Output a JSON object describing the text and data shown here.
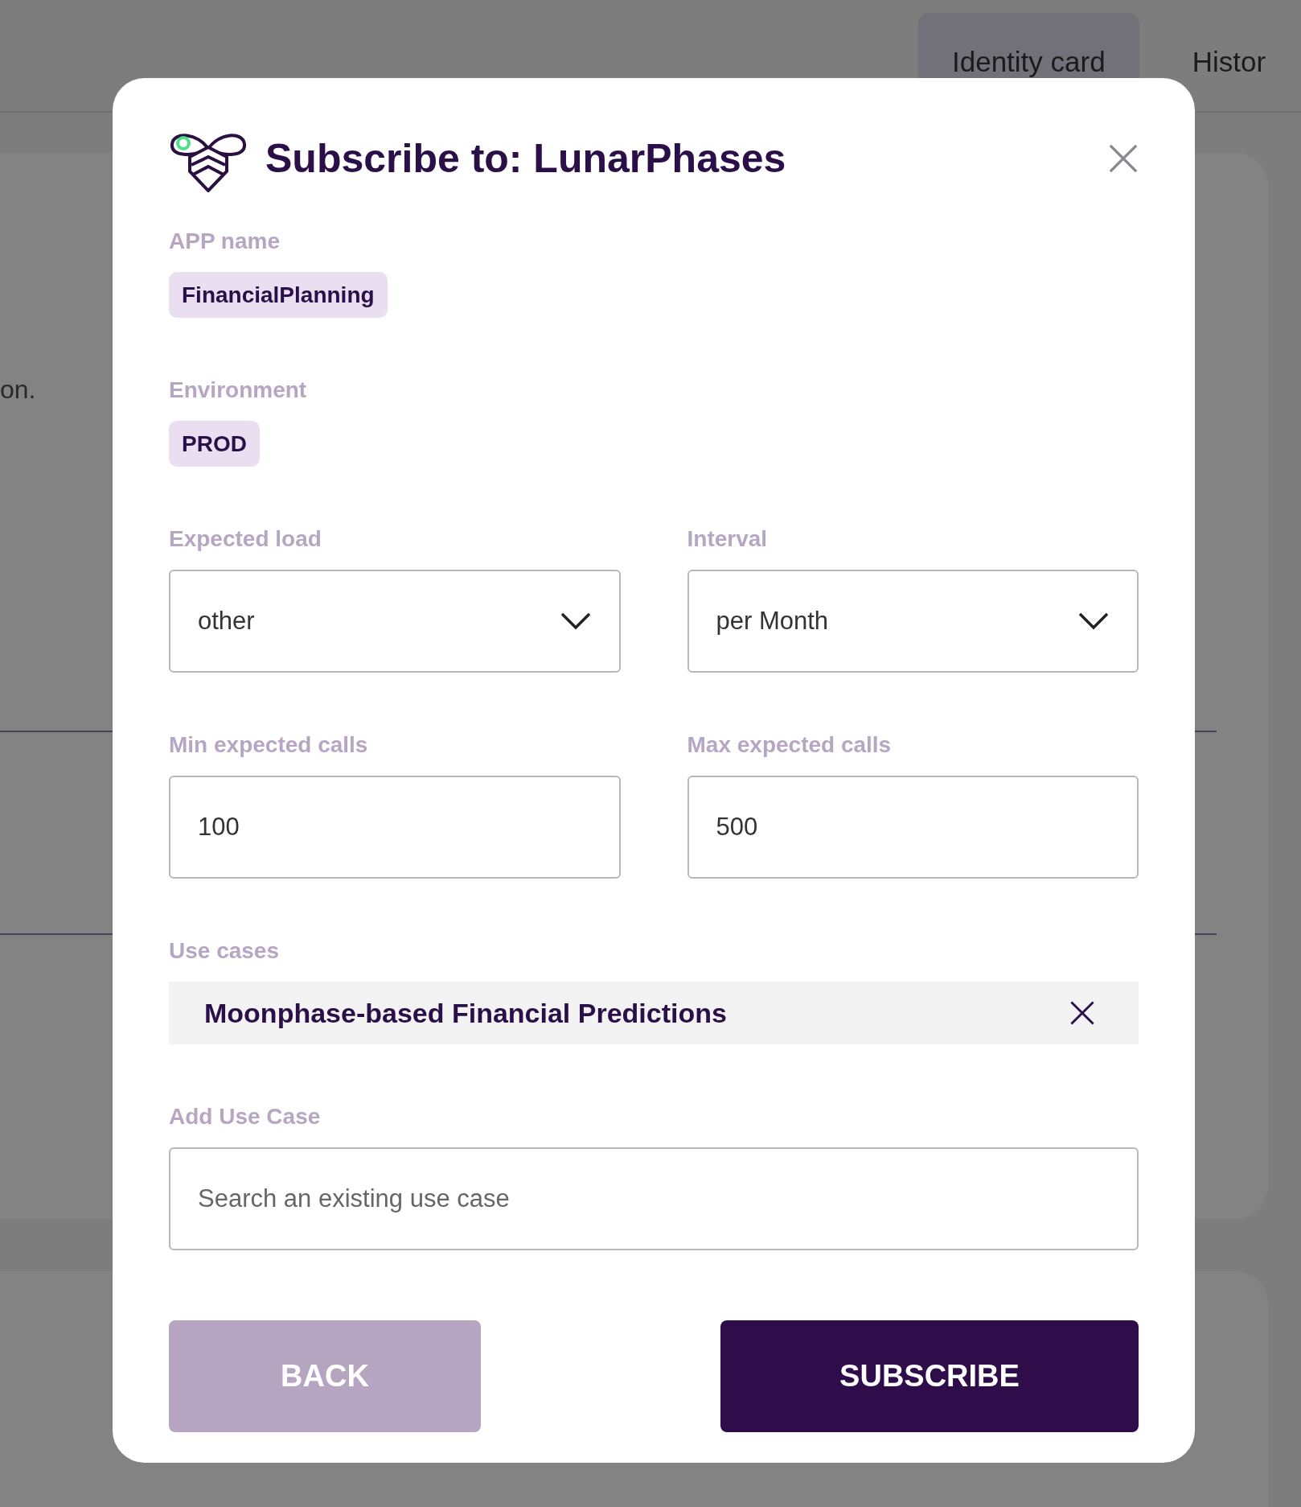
{
  "background": {
    "tabs": [
      {
        "label": "Identity card",
        "selected": true
      },
      {
        "label": "Histor",
        "selected": false
      }
    ],
    "text_fragment": "on."
  },
  "dialog": {
    "title": "Subscribe to: LunarPhases",
    "app_name": {
      "label": "APP name",
      "value": "FinancialPlanning"
    },
    "environment": {
      "label": "Environment",
      "value": "PROD"
    },
    "fields": [
      {
        "label": "Expected load",
        "kind": "select",
        "value": "other"
      },
      {
        "label": "Interval",
        "kind": "select",
        "value": "per Month"
      },
      {
        "label": "Min expected calls",
        "kind": "input",
        "value": "100"
      },
      {
        "label": "Max expected calls",
        "kind": "input",
        "value": "500"
      }
    ],
    "use_cases": {
      "label": "Use cases",
      "items": [
        "Moonphase-based Financial Predictions"
      ]
    },
    "add_use_case": {
      "label": "Add Use Case",
      "placeholder": "Search an existing use case"
    },
    "buttons": [
      {
        "label": "BACK",
        "kind": "secondary"
      },
      {
        "label": "SUBSCRIBE",
        "kind": "primary"
      }
    ]
  }
}
